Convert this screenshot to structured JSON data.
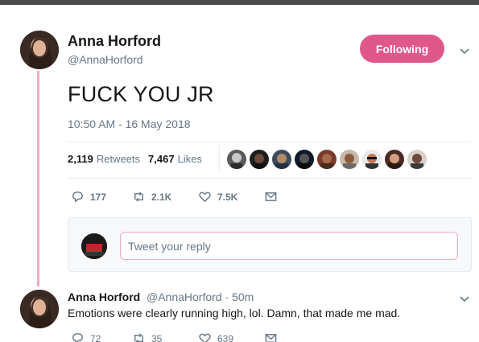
{
  "tweet": {
    "author_name": "Anna Horford",
    "author_handle": "@AnnaHorford",
    "follow_label": "Following",
    "text": "FUCK YOU JR",
    "timestamp": "10:50 AM - 16 May 2018",
    "retweets_count": "2,119",
    "retweets_label": "Retweets",
    "likes_count": "7,467",
    "likes_label": "Likes",
    "replies_action": "177",
    "retweets_action": "2.1K",
    "likes_action": "7.5K",
    "reply_placeholder": "Tweet your reply"
  },
  "reply_tweet": {
    "author_name": "Anna Horford",
    "author_handle": "@AnnaHorford",
    "time": "· 50m",
    "text": "Emotions were clearly running high, lol. Damn, that made me mad.",
    "replies": "72",
    "retweets": "35",
    "likes": "639"
  },
  "colors": {
    "accent": "#e0588a",
    "thread_line": "#e8aec5",
    "muted_text": "#657786",
    "primary_text": "#14171a"
  },
  "icons": {
    "reply": "speech-bubble-icon",
    "retweet": "retweet-arrows-icon",
    "like": "heart-icon",
    "dm": "envelope-icon",
    "more": "chevron-down-icon"
  }
}
